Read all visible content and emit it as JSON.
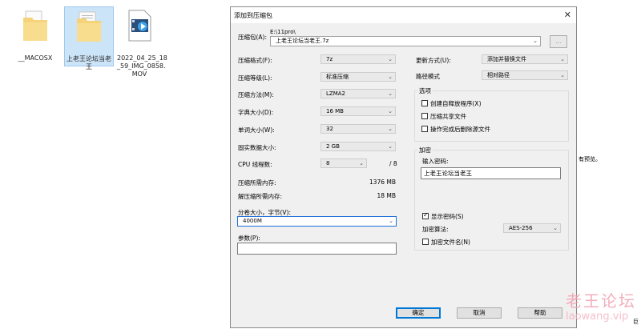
{
  "desktop": {
    "items": [
      {
        "label": "__MACOSX",
        "icon": "folder-icon"
      },
      {
        "label": "上老王论坛当老\n王",
        "icon": "folder-icon"
      },
      {
        "label": "2022_04_25_18\n_59_IMG_0858.\nMOV",
        "icon": "video-file-icon"
      }
    ],
    "side_text_right": "有预览。",
    "side_text_bottom": "巨"
  },
  "dialog": {
    "title": "添加到压缩包",
    "close_label": "✕",
    "archive": {
      "label": "压缩包(A):",
      "path": "E:\\11pro\\",
      "value": "上老王论坛当老王.7z",
      "browse_label": "..."
    },
    "left": {
      "format": {
        "label": "压缩格式(F):",
        "value": "7z"
      },
      "level": {
        "label": "压缩等级(L):",
        "value": "标准压缩"
      },
      "method": {
        "label": "压缩方法(M):",
        "value": "LZMA2"
      },
      "dict": {
        "label": "字典大小(D):",
        "value": "16 MB"
      },
      "word": {
        "label": "单词大小(W):",
        "value": "32"
      },
      "solid": {
        "label": "固实数据大小:",
        "value": "2 GB"
      },
      "cpu": {
        "label": "CPU 线程数:",
        "value": "8",
        "max": "/ 8"
      },
      "mem_compress": {
        "label": "压缩所需内存:",
        "value": "1376 MB"
      },
      "mem_decompress": {
        "label": "解压缩所需内存:",
        "value": "18 MB"
      },
      "split": {
        "label": "分卷大小，字节(V):",
        "value": "4000M"
      },
      "params": {
        "label": "参数(P):",
        "value": ""
      }
    },
    "right": {
      "update_mode": {
        "label": "更新方式(U):",
        "value": "添加并替换文件"
      },
      "path_mode": {
        "label": "路径模式",
        "value": "相对路径"
      },
      "options": {
        "title": "选项",
        "items": [
          {
            "label": "创建自释放程序(X)",
            "checked": false
          },
          {
            "label": "压缩共享文件",
            "checked": false
          },
          {
            "label": "操作完成后删除源文件",
            "checked": false
          }
        ]
      },
      "encryption": {
        "title": "加密",
        "password_label": "输入密码:",
        "password_value": "上老王论坛当老王",
        "show_password": {
          "label": "显示密码(S)",
          "checked": true
        },
        "algo_label": "加密算法:",
        "algo_value": "AES-256",
        "encrypt_names": {
          "label": "加密文件名(N)",
          "checked": false
        }
      }
    },
    "buttons": {
      "ok": "确定",
      "cancel": "取消",
      "help": "帮助"
    }
  },
  "watermark": {
    "text": "老王论坛",
    "url": "laowang.vip"
  }
}
